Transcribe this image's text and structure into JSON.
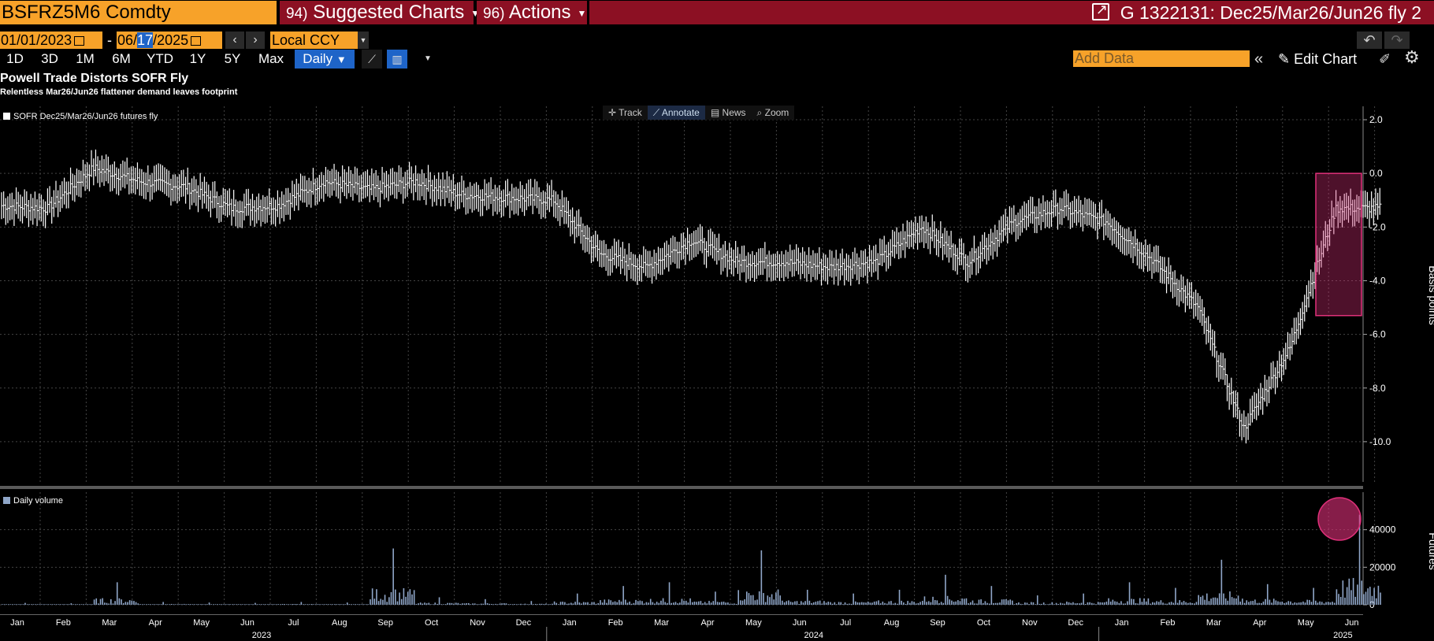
{
  "header": {
    "ticker": "BSFRZ5M6 Comdty",
    "suggested_num": "94)",
    "suggested_label": "Suggested Charts",
    "actions_num": "96)",
    "actions_label": "Actions",
    "title": "G 1322131: Dec25/Mar26/Jun26 fly 2"
  },
  "controls": {
    "start_date": "01/01/2023",
    "date_sep": "-",
    "end_date_mm": "06/",
    "end_date_dd": "17",
    "end_date_yy": "/2025",
    "currency": "Local CCY",
    "periods": [
      "1D",
      "3D",
      "1M",
      "6M",
      "YTD",
      "1Y",
      "5Y",
      "Max"
    ],
    "frequency": "Daily",
    "add_data_placeholder": "Add Data",
    "edit_chart": "Edit Chart"
  },
  "chart_tools": {
    "track": "Track",
    "annotate": "Annotate",
    "news": "News",
    "zoom": "Zoom"
  },
  "colors": {
    "accent_orange": "#f7a229",
    "menu_red": "#8c1023",
    "highlight": "#e0307a",
    "volume": "#8fa6c8",
    "active_blue": "#1e64c8"
  },
  "chart_data": [
    {
      "type": "line",
      "title": "Powell Trade Distorts SOFR Fly",
      "subtitle": "Relentless Mar26/Jun26 flattener demand leaves footprint",
      "ylabel": "Basis points",
      "legend": "SOFR Dec25/Mar26/Jun26 futures fly",
      "ylim": [
        -11.5,
        2.5
      ],
      "yticks": [
        "2.0",
        "0.0",
        "-2.0",
        "-4.0",
        "-6.0",
        "-8.0",
        "-10.0"
      ],
      "x_months": [
        "Jan",
        "Feb",
        "Mar",
        "Apr",
        "May",
        "Jun",
        "Jul",
        "Aug",
        "Sep",
        "Oct",
        "Nov",
        "Dec",
        "Jan",
        "Feb",
        "Mar",
        "Apr",
        "May",
        "Jun",
        "Jul",
        "Aug",
        "Sep",
        "Oct",
        "Nov",
        "Dec",
        "Jan",
        "Feb",
        "Mar",
        "Apr",
        "May",
        "Jun"
      ],
      "x_years": [
        "2023",
        "2024",
        "2025"
      ],
      "x": [
        "2023-01",
        "2023-02",
        "2023-03",
        "2023-04",
        "2023-05",
        "2023-06",
        "2023-07",
        "2023-08",
        "2023-09",
        "2023-10",
        "2023-11",
        "2023-12",
        "2024-01",
        "2024-02",
        "2024-03",
        "2024-04",
        "2024-05",
        "2024-06",
        "2024-07",
        "2024-08",
        "2024-09",
        "2024-10",
        "2024-11",
        "2024-12",
        "2025-01",
        "2025-02",
        "2025-03",
        "2025-04",
        "2025-05",
        "2025-06"
      ],
      "series": [
        {
          "values": [
            -1.2,
            -1.3,
            0.2,
            -0.3,
            -0.5,
            -1.3,
            -1.2,
            -0.3,
            -0.6,
            -0.3,
            -0.8,
            -0.9,
            -1.0,
            -3.0,
            -3.5,
            -2.5,
            -3.3,
            -3.3,
            -3.5,
            -3.3,
            -2.0,
            -3.3,
            -1.8,
            -1.3,
            -1.8,
            -3.2,
            -5.0,
            -9.5,
            -6.5,
            -1.3
          ],
          "color": "#ffffff"
        }
      ],
      "grid": true,
      "highlight": "box around Jun 2025 rally"
    },
    {
      "type": "bar",
      "legend": "Daily volume",
      "ylabel": "Futures",
      "ylim": [
        0,
        60000
      ],
      "yticks": [
        "40000",
        "20000",
        "0"
      ],
      "x": [
        "2023-01",
        "2023-02",
        "2023-03",
        "2023-04",
        "2023-05",
        "2023-06",
        "2023-07",
        "2023-08",
        "2023-09",
        "2023-10",
        "2023-11",
        "2023-12",
        "2024-01",
        "2024-02",
        "2024-03",
        "2024-04",
        "2024-05",
        "2024-06",
        "2024-07",
        "2024-08",
        "2024-09",
        "2024-10",
        "2024-11",
        "2024-12",
        "2025-01",
        "2025-02",
        "2025-03",
        "2025-04",
        "2025-05",
        "2025-06"
      ],
      "series": [
        {
          "values": [
            1000,
            800,
            12000,
            1500,
            1200,
            1000,
            1500,
            1200,
            30000,
            4000,
            3000,
            2000,
            6000,
            10000,
            12000,
            7000,
            29000,
            8000,
            6000,
            8000,
            16000,
            10000,
            5000,
            6000,
            12000,
            9000,
            24000,
            11000,
            9000,
            48000
          ],
          "color": "#8fa6c8"
        }
      ],
      "grid": true,
      "highlight": "circle around Jun 2025 volume spike"
    }
  ]
}
